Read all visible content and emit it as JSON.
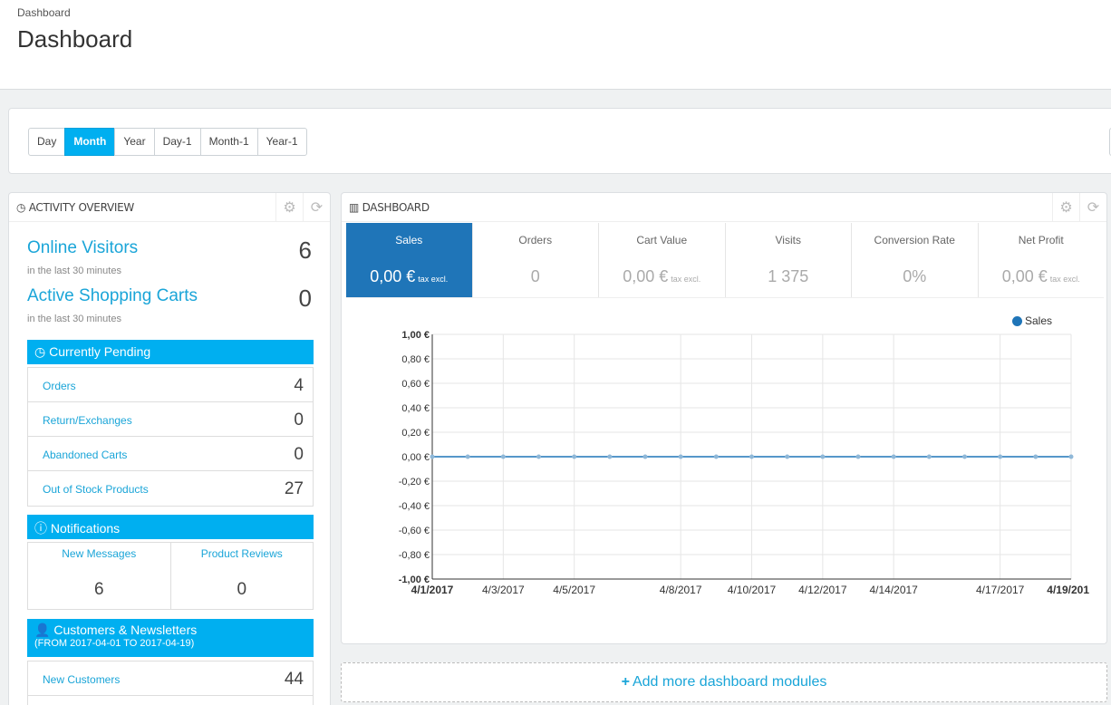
{
  "header": {
    "breadcrumb": "Dashboard",
    "title": "Dashboard"
  },
  "date_ranges": [
    {
      "label": "Day",
      "active": false
    },
    {
      "label": "Month",
      "active": true
    },
    {
      "label": "Year",
      "active": false
    },
    {
      "label": "Day-1",
      "active": false
    },
    {
      "label": "Month-1",
      "active": false
    },
    {
      "label": "Year-1",
      "active": false
    }
  ],
  "activity": {
    "title": "ACTIVITY OVERVIEW",
    "online_visitors": {
      "label": "Online Visitors",
      "note": "in the last 30 minutes",
      "value": "6"
    },
    "active_carts": {
      "label": "Active Shopping Carts",
      "note": "in the last 30 minutes",
      "value": "0"
    },
    "pending": {
      "title": "Currently Pending",
      "rows": [
        {
          "label": "Orders",
          "value": "4"
        },
        {
          "label": "Return/Exchanges",
          "value": "0"
        },
        {
          "label": "Abandoned Carts",
          "value": "0"
        },
        {
          "label": "Out of Stock Products",
          "value": "27"
        }
      ]
    },
    "notifications": {
      "title": "Notifications",
      "cells": [
        {
          "label": "New Messages",
          "value": "6"
        },
        {
          "label": "Product Reviews",
          "value": "0"
        }
      ]
    },
    "customers": {
      "title": "Customers & Newsletters",
      "subtitle": "(FROM 2017-04-01 TO 2017-04-19)",
      "rows": [
        {
          "label": "New Customers",
          "value": "44"
        }
      ]
    }
  },
  "dashboard": {
    "title": "DASHBOARD",
    "kpis": [
      {
        "label": "Sales",
        "value": "0,00 €",
        "unit": "tax excl.",
        "active": true
      },
      {
        "label": "Orders",
        "value": "0",
        "unit": "",
        "active": false
      },
      {
        "label": "Cart Value",
        "value": "0,00 €",
        "unit": "tax excl.",
        "active": false
      },
      {
        "label": "Visits",
        "value": "1 375",
        "unit": "",
        "active": false
      },
      {
        "label": "Conversion Rate",
        "value": "0%",
        "unit": "",
        "active": false
      },
      {
        "label": "Net Profit",
        "value": "0,00 €",
        "unit": "tax excl.",
        "active": false
      }
    ]
  },
  "chart_data": {
    "type": "line",
    "legend": "Sales",
    "legend_position": "top-right",
    "y_ticks": [
      "1,00 €",
      "0,80 €",
      "0,60 €",
      "0,40 €",
      "0,20 €",
      "0,00 €",
      "-0,20 €",
      "-0,40 €",
      "-0,60 €",
      "-0,80 €",
      "-1,00 €"
    ],
    "x_ticks": [
      "4/1/2017",
      "4/3/2017",
      "4/5/2017",
      "4/8/2017",
      "4/10/2017",
      "4/12/2017",
      "4/14/2017",
      "4/17/2017",
      "4/19/201"
    ],
    "ylim": [
      -1,
      1
    ],
    "grid": true,
    "series": [
      {
        "name": "Sales",
        "color": "#1f75b8",
        "values": [
          0,
          0,
          0,
          0,
          0,
          0,
          0,
          0,
          0,
          0,
          0,
          0,
          0,
          0,
          0,
          0,
          0,
          0,
          0
        ]
      }
    ]
  },
  "footer": {
    "add_modules": "Add more dashboard modules"
  }
}
